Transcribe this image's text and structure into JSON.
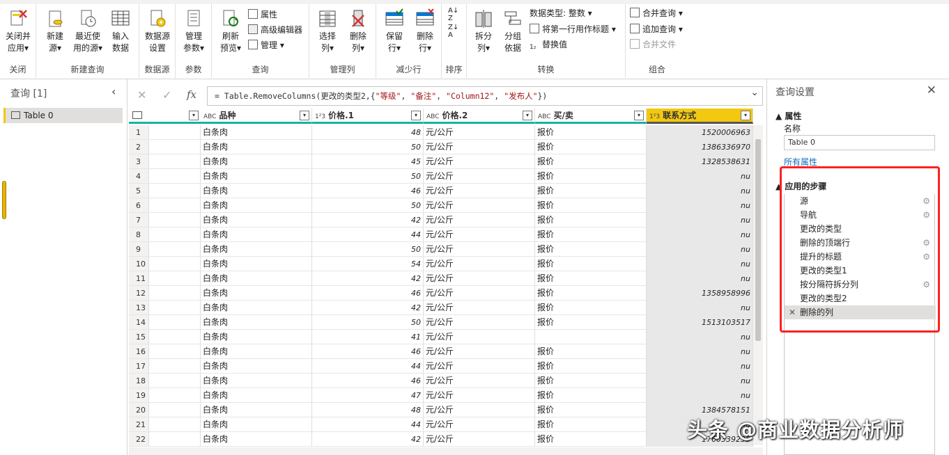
{
  "ribbon": {
    "groups": [
      {
        "label": "关闭"
      },
      {
        "label": "新建查询"
      },
      {
        "label": "数据源"
      },
      {
        "label": "参数"
      },
      {
        "label": "查询"
      },
      {
        "label": "管理列"
      },
      {
        "label": "减少行"
      },
      {
        "label": "排序"
      },
      {
        "label": "转换"
      },
      {
        "label": "组合"
      }
    ],
    "buttons": {
      "close_apply": "关闭并\n应用▾",
      "new_source": "新建\n源▾",
      "recent_source": "最近使\n用的源▾",
      "enter_data": "输入\n数据",
      "datasource_settings": "数据源\n设置",
      "manage_params": "管理\n参数▾",
      "refresh_preview": "刷新\n预览▾",
      "properties": "属性",
      "advanced_editor": "高级编辑器",
      "manage": "管理 ▾",
      "choose_cols": "选择\n列▾",
      "remove_cols": "删除\n列▾",
      "keep_rows": "保留\n行▾",
      "remove_rows": "删除\n行▾",
      "split_col": "拆分\n列▾",
      "group_by": "分组\n依据",
      "data_type": "数据类型: 整数 ▾",
      "first_row_header": "将第一行用作标题 ▾",
      "replace_values": "替换值",
      "merge_queries": "合并查询 ▾",
      "append_queries": "追加查询 ▾",
      "combine_files": "合并文件"
    }
  },
  "left_pane": {
    "title": "查询 [1]",
    "items": [
      {
        "label": "Table 0"
      }
    ]
  },
  "formula": {
    "prefix": "= Table.RemoveColumns(更改的类型2,{",
    "s1": "\"等级\"",
    "s2": "\"备注\"",
    "s3": "\"Column12\"",
    "s4": "\"发布人\"",
    "suffix": "})"
  },
  "grid": {
    "columns": [
      {
        "type": "ABC",
        "name": "品种"
      },
      {
        "type": "123",
        "name": "价格.1"
      },
      {
        "type": "ABC",
        "name": "价格.2"
      },
      {
        "type": "ABC",
        "name": "买/卖"
      },
      {
        "type": "123",
        "name": "联系方式"
      }
    ],
    "rows": [
      [
        "1",
        "白条肉",
        "48",
        "元/公斤",
        "报价",
        "1520006963"
      ],
      [
        "2",
        "白条肉",
        "50",
        "元/公斤",
        "报价",
        "1386336970"
      ],
      [
        "3",
        "白条肉",
        "45",
        "元/公斤",
        "报价",
        "1328538631"
      ],
      [
        "4",
        "白条肉",
        "50",
        "元/公斤",
        "报价",
        "nu"
      ],
      [
        "5",
        "白条肉",
        "46",
        "元/公斤",
        "报价",
        "nu"
      ],
      [
        "6",
        "白条肉",
        "50",
        "元/公斤",
        "报价",
        "nu"
      ],
      [
        "7",
        "白条肉",
        "42",
        "元/公斤",
        "报价",
        "nu"
      ],
      [
        "8",
        "白条肉",
        "44",
        "元/公斤",
        "报价",
        "nu"
      ],
      [
        "9",
        "白条肉",
        "50",
        "元/公斤",
        "报价",
        "nu"
      ],
      [
        "10",
        "白条肉",
        "54",
        "元/公斤",
        "报价",
        "nu"
      ],
      [
        "11",
        "白条肉",
        "42",
        "元/公斤",
        "报价",
        "nu"
      ],
      [
        "12",
        "白条肉",
        "46",
        "元/公斤",
        "报价",
        "1358958996"
      ],
      [
        "13",
        "白条肉",
        "42",
        "元/公斤",
        "报价",
        "nu"
      ],
      [
        "14",
        "白条肉",
        "50",
        "元/公斤",
        "报价",
        "1513103517"
      ],
      [
        "15",
        "白条肉",
        "41",
        "元/公斤",
        "",
        "nu"
      ],
      [
        "16",
        "白条肉",
        "46",
        "元/公斤",
        "报价",
        "nu"
      ],
      [
        "17",
        "白条肉",
        "44",
        "元/公斤",
        "报价",
        "nu"
      ],
      [
        "18",
        "白条肉",
        "46",
        "元/公斤",
        "报价",
        "nu"
      ],
      [
        "19",
        "白条肉",
        "47",
        "元/公斤",
        "报价",
        "nu"
      ],
      [
        "20",
        "白条肉",
        "48",
        "元/公斤",
        "报价",
        "1384578151"
      ],
      [
        "21",
        "白条肉",
        "44",
        "元/公斤",
        "报价",
        "nu"
      ],
      [
        "22",
        "白条肉",
        "42",
        "元/公斤",
        "报价",
        "1760339235"
      ]
    ]
  },
  "right_pane": {
    "title": "查询设置",
    "properties": "▲ 属性",
    "name_label": "名称",
    "name_value": "Table 0",
    "all_props": "所有属性",
    "applied_steps": "▲ 应用的步骤",
    "steps": [
      {
        "label": "源",
        "gear": true
      },
      {
        "label": "导航",
        "gear": true
      },
      {
        "label": "更改的类型",
        "gear": false
      },
      {
        "label": "删除的顶端行",
        "gear": true
      },
      {
        "label": "提升的标题",
        "gear": true
      },
      {
        "label": "更改的类型1",
        "gear": false
      },
      {
        "label": "按分隔符拆分列",
        "gear": true
      },
      {
        "label": "更改的类型2",
        "gear": false
      },
      {
        "label": "删除的列",
        "gear": false,
        "active": true
      }
    ]
  },
  "watermark": "头条 @商业数据分析师",
  "colors": {
    "accent": "#f2c811",
    "teal": "#16b2a3",
    "highlight": "#ff2020"
  }
}
